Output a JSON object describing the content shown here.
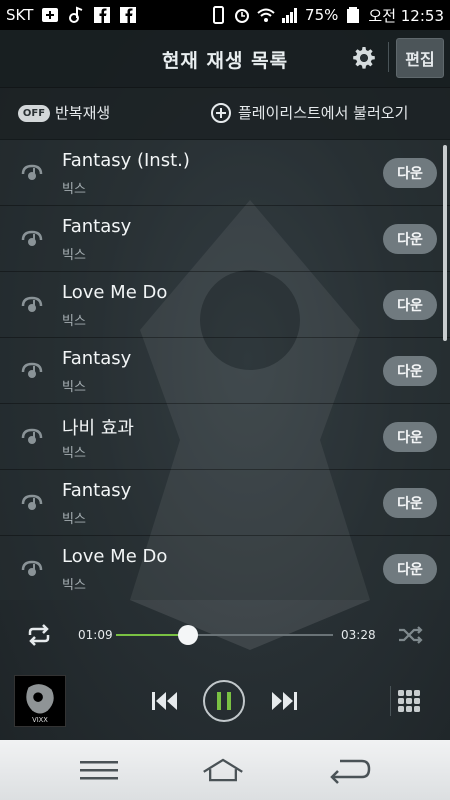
{
  "status_bar": {
    "carrier": "SKT",
    "battery": "75%",
    "time": "오전 12:53",
    "icons": [
      "add-box-icon",
      "music-note-icon",
      "facebook-icon",
      "facebook-icon",
      "phone-icon",
      "alarm-icon",
      "wifi-icon",
      "signal-icon",
      "battery-icon"
    ]
  },
  "header": {
    "title": "현재 재생 목록",
    "edit_label": "편집",
    "settings_icon": "gear-icon"
  },
  "options": {
    "repeat_toggle": "OFF",
    "repeat_label": "반복재생",
    "load_playlist_label": "플레이리스트에서 불러오기"
  },
  "playlist": [
    {
      "title": "Fantasy (Inst.)",
      "artist": "빅스",
      "action": "다운"
    },
    {
      "title": "Fantasy",
      "artist": "빅스",
      "action": "다운"
    },
    {
      "title": "Love Me Do",
      "artist": "빅스",
      "action": "다운"
    },
    {
      "title": "Fantasy",
      "artist": "빅스",
      "action": "다운"
    },
    {
      "title": "나비 효과",
      "artist": "빅스",
      "action": "다운"
    },
    {
      "title": "Fantasy",
      "artist": "빅스",
      "action": "다운"
    },
    {
      "title": "Love Me Do",
      "artist": "빅스",
      "action": "다운"
    }
  ],
  "player": {
    "elapsed": "01:09",
    "duration": "03:28",
    "progress": 0.33,
    "state": "playing",
    "album_art_text": "VIXX"
  },
  "colors": {
    "accent": "#7ac143",
    "button": "#707a7f",
    "background": "#1f2528"
  }
}
